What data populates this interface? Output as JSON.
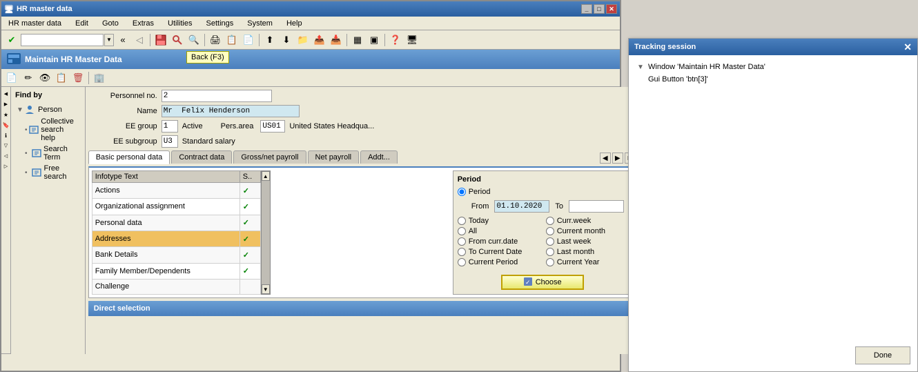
{
  "main_window": {
    "title": "HR master data",
    "tooltip": "Back  (F3)"
  },
  "menu": {
    "items": [
      {
        "label": "HR master data"
      },
      {
        "label": "Edit"
      },
      {
        "label": "Goto"
      },
      {
        "label": "Extras"
      },
      {
        "label": "Utilities"
      },
      {
        "label": "Settings"
      },
      {
        "label": "System"
      },
      {
        "label": "Help"
      }
    ]
  },
  "content_header": {
    "title": "Maintain HR Master Data"
  },
  "form": {
    "personnel_no_label": "Personnel no.",
    "personnel_no_value": "2",
    "name_label": "Name",
    "name_value": "Mr  Felix Henderson",
    "ee_group_label": "EE group",
    "ee_group_value": "1",
    "ee_group_text": "Active",
    "pers_area_label": "Pers.area",
    "pers_area_code": "US01",
    "pers_area_text": "United States Headqua...",
    "ee_subgroup_label": "EE subgroup",
    "ee_subgroup_value": "U3",
    "ee_subgroup_text": "Standard salary"
  },
  "tabs": {
    "items": [
      {
        "label": "Basic personal data",
        "active": true
      },
      {
        "label": "Contract data",
        "active": false
      },
      {
        "label": "Gross/net payroll",
        "active": false
      },
      {
        "label": "Net payroll",
        "active": false
      },
      {
        "label": "Addt...",
        "active": false
      }
    ]
  },
  "infotype_table": {
    "columns": [
      "Infotype Text",
      "S.."
    ],
    "rows": [
      {
        "text": "Actions",
        "status": "✓",
        "selected": false
      },
      {
        "text": "Organizational assignment",
        "status": "✓",
        "selected": false
      },
      {
        "text": "Personal data",
        "status": "✓",
        "selected": false
      },
      {
        "text": "Addresses",
        "status": "✓",
        "selected": true
      },
      {
        "text": "Bank Details",
        "status": "✓",
        "selected": false
      },
      {
        "text": "Family Member/Dependents",
        "status": "✓",
        "selected": false
      },
      {
        "text": "Challenge",
        "status": "",
        "selected": false
      }
    ]
  },
  "period": {
    "title": "Period",
    "radio_period_label": "Period",
    "from_label": "From",
    "from_value": "01.10.2020",
    "to_label": "To",
    "today_label": "Today",
    "curr_week_label": "Curr.week",
    "all_label": "All",
    "current_month_label": "Current month",
    "from_curr_date_label": "From curr.date",
    "last_week_label": "Last week",
    "to_current_date_label": "To Current Date",
    "last_month_label": "Last month",
    "current_period_label": "Current Period",
    "current_year_label": "Current Year",
    "choose_label": "Choose"
  },
  "find_by": {
    "label": "Find by",
    "person_label": "Person",
    "collective_search_label": "Collective search help",
    "search_term_label": "Search Term",
    "free_search_label": "Free search"
  },
  "direct_selection": {
    "label": "Direct selection"
  },
  "tracking": {
    "title": "Tracking session",
    "window_label": "Window 'Maintain HR Master Data'",
    "gui_button_label": "Gui Button 'btn[3]'",
    "done_label": "Done"
  }
}
